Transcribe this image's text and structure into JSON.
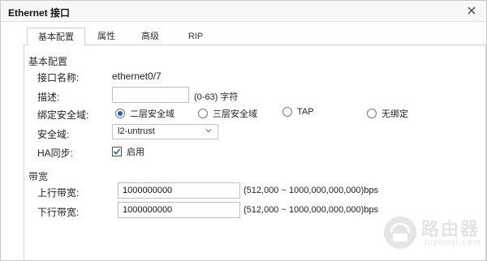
{
  "window": {
    "title": "Ethernet 接口"
  },
  "tabs": [
    {
      "label": "基本配置",
      "active": true
    },
    {
      "label": "属性",
      "active": false
    },
    {
      "label": "高级",
      "active": false
    },
    {
      "label": "RIP",
      "active": false
    }
  ],
  "basic": {
    "section_title": "基本配置",
    "interface_name_label": "接口名称:",
    "interface_name_value": "ethernet0/7",
    "description_label": "描述:",
    "description_value": "",
    "description_hint": "(0-63) 字符",
    "binding_label": "绑定安全域:",
    "binding_options": [
      {
        "label": "二层安全域",
        "selected": true
      },
      {
        "label": "三层安全域",
        "selected": false
      },
      {
        "label": "TAP",
        "selected": false
      },
      {
        "label": "无绑定",
        "selected": false
      }
    ],
    "zone_label": "安全域:",
    "zone_value": "l2-untrust",
    "ha_label": "HA同步:",
    "ha_checkbox_label": "启用",
    "ha_enabled": true
  },
  "bandwidth": {
    "section_title": "带宽",
    "upstream_label": "上行带宽:",
    "upstream_value": "1000000000",
    "upstream_hint": "(512,000 ~ 1000,000,000,000)bps",
    "downstream_label": "下行带宽:",
    "downstream_value": "1000000000",
    "downstream_hint": "(512,000 ~ 1000,000,000,000)bps"
  },
  "watermark": {
    "text": "路由器",
    "subtext": "luyouqi.com"
  },
  "colors": {
    "accent": "#1e5fb8",
    "titlebar": "#f7f7f7",
    "border": "#cfcfcf"
  }
}
